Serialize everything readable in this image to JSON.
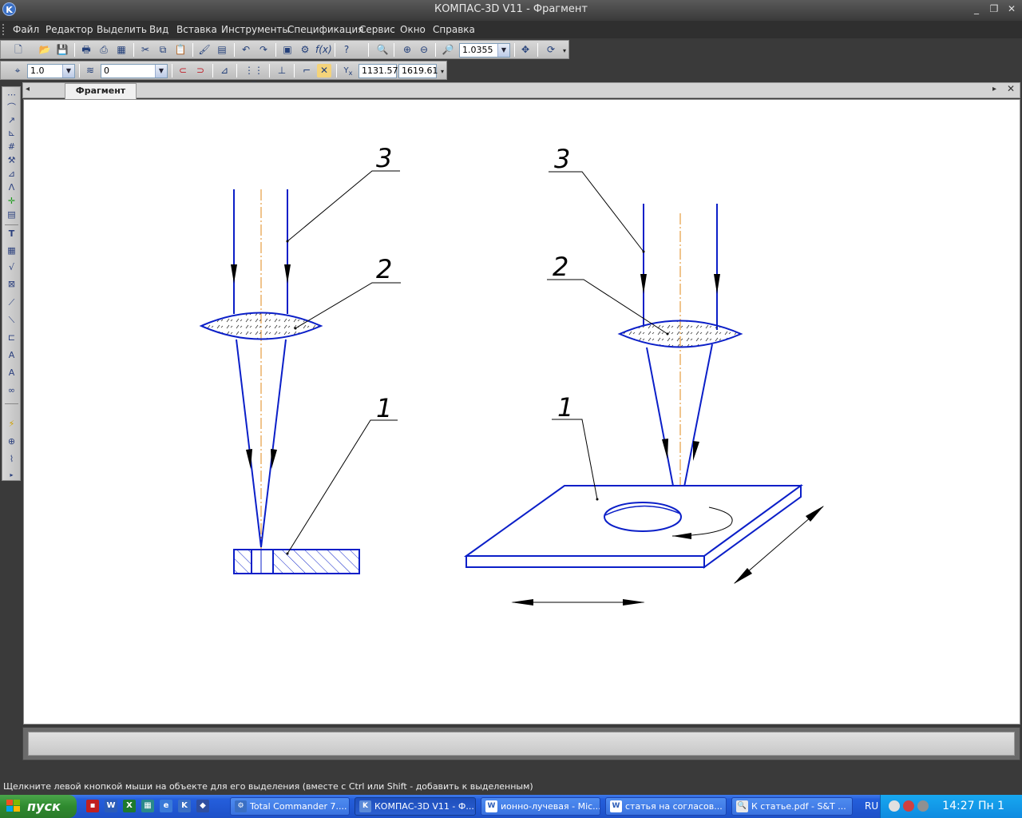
{
  "window": {
    "title": "КОМПАС-3D V11 - Фрагмент",
    "minimize": "_",
    "restore": "❐",
    "close": "✕"
  },
  "menu": [
    "Файл",
    "Редактор",
    "Выделить",
    "Вид",
    "Вставка",
    "Инструменты",
    "Спецификация",
    "Сервис",
    "Окно",
    "Справка"
  ],
  "toolbar": {
    "zoom_value": "1.0355",
    "step_value": "1.0",
    "layer_value": "0",
    "coord_x": "1131.57",
    "coord_y": "1619.61"
  },
  "document_tab": {
    "label": "Фрагмент"
  },
  "drawing": {
    "labels": {
      "left_3": "3",
      "left_2": "2",
      "left_1": "1",
      "right_3": "3",
      "right_2": "2",
      "right_1": "1"
    },
    "colors": {
      "line": "#0b1fc8",
      "axis": "#e08a1a",
      "leader": "#000000"
    }
  },
  "status": {
    "hint": "Щелкните левой кнопкой мыши на объекте для его выделения (вместе с Ctrl или Shift - добавить к выделенным)"
  },
  "taskbar": {
    "start": "пуск",
    "buttons": [
      {
        "label": "Total Commander 7....",
        "icon": "total-commander-icon"
      },
      {
        "label": "КОМПАС-3D V11 - Ф....",
        "icon": "kompas-icon"
      },
      {
        "label": "ионно-лучевая - Mic...",
        "icon": "word-icon"
      },
      {
        "label": "статья на согласов...",
        "icon": "word-icon"
      },
      {
        "label": "К статье.pdf - S&T ...",
        "icon": "pdf-viewer-icon"
      }
    ],
    "lang": "RU",
    "clock": "14:27 Пн 1"
  }
}
